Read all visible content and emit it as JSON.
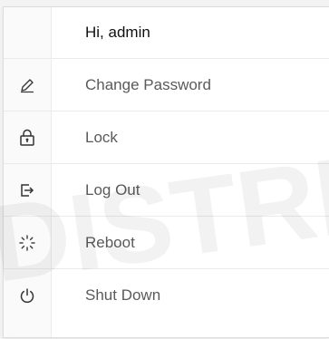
{
  "menu": {
    "greeting": "Hi, admin",
    "items": [
      {
        "label": "Change Password",
        "icon": "pencil-icon"
      },
      {
        "label": "Lock",
        "icon": "lock-icon"
      },
      {
        "label": "Log Out",
        "icon": "logout-icon"
      },
      {
        "label": "Reboot",
        "icon": "reboot-icon"
      },
      {
        "label": "Shut Down",
        "icon": "power-icon"
      }
    ]
  },
  "watermark": {
    "text": "DISTRIBU"
  },
  "colors": {
    "text": "#5a5a5a",
    "header_text": "#111111",
    "divider": "#eaeaea",
    "background": "#ffffff"
  }
}
